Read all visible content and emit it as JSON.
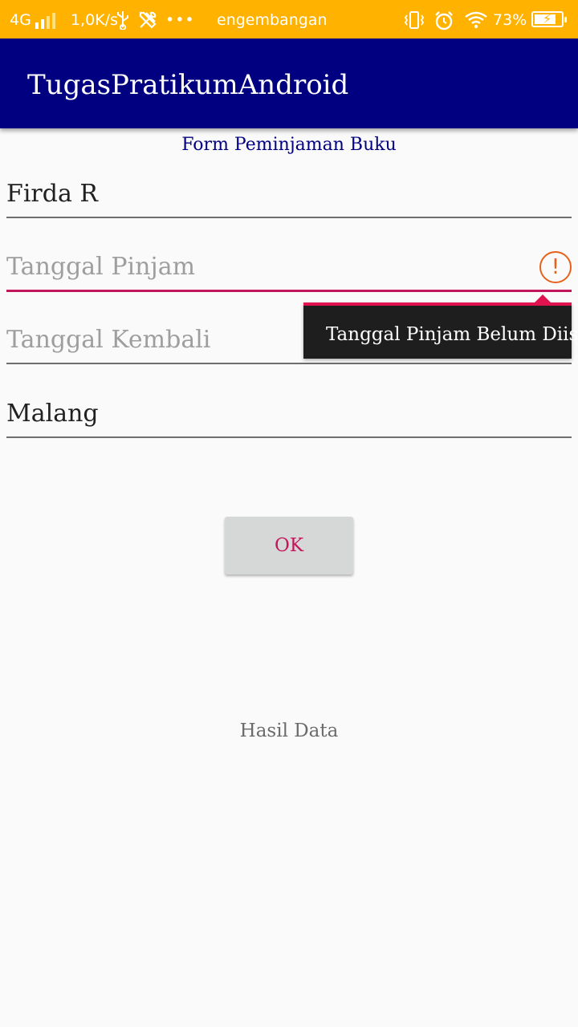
{
  "status_bar": {
    "network": "4G",
    "speed": "1,0K/s",
    "usb_icon": "usb-icon",
    "tools_icon": "tools-icon",
    "more": "•••",
    "notification_text": "engembangan",
    "vibrate_icon": "vibrate-icon",
    "alarm_icon": "alarm-icon",
    "wifi_icon": "wifi-icon",
    "battery": "73%",
    "battery_level": 0.73,
    "color": "#ffb300"
  },
  "app_bar": {
    "title": "TugasPratikumAndroid",
    "color": "#000080"
  },
  "form": {
    "title": "Form Peminjaman Buku",
    "fields": [
      {
        "value": "Firda R",
        "placeholder": ""
      },
      {
        "value": "",
        "placeholder": "Tanggal Pinjam",
        "error": true
      },
      {
        "value": "",
        "placeholder": "Tanggal Kembali",
        "error_icon": true
      },
      {
        "value": "Malang",
        "placeholder": ""
      }
    ],
    "error_message": "Tanggal Pinjam Belum Diisi",
    "error_icon_glyph": "!",
    "ok_label": "OK",
    "result_label": "Hasil Data",
    "accent_color": "#c2185b"
  }
}
